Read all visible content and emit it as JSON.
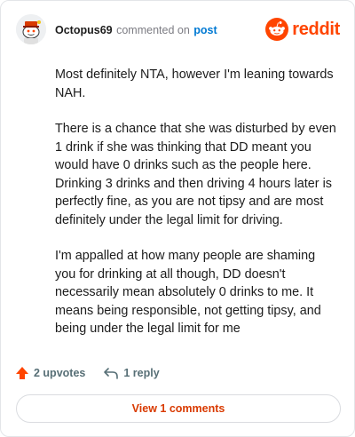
{
  "comment": {
    "username": "Octopus69",
    "action_text": "commented on",
    "post_link": "post",
    "paragraphs": [
      "Most definitely NTA, however I'm leaning towards NAH.",
      "There is a chance that she was disturbed by even 1 drink if she was thinking that DD meant you would have 0 drinks such as the people here. Drinking 3 drinks and then driving 4 hours later is perfectly fine, as you are not tipsy and are most definitely under the legal limit for driving.",
      "I'm appalled at how many people are shaming you for drinking at all though, DD doesn't necessarily mean absolutely 0 drinks to me. It means being responsible, not getting tipsy, and being under the legal limit for me"
    ]
  },
  "brand": {
    "name": "reddit",
    "color": "#ff4500"
  },
  "actions": {
    "upvotes_label": "2 upvotes",
    "reply_label": "1 reply",
    "upvote_icon": "arrow-up-icon",
    "reply_icon": "reply-arrow-icon"
  },
  "view_comments_label": "View 1 comments",
  "colors": {
    "accent": "#ff4500",
    "link": "#0079d3",
    "button_text": "#d93a00"
  }
}
